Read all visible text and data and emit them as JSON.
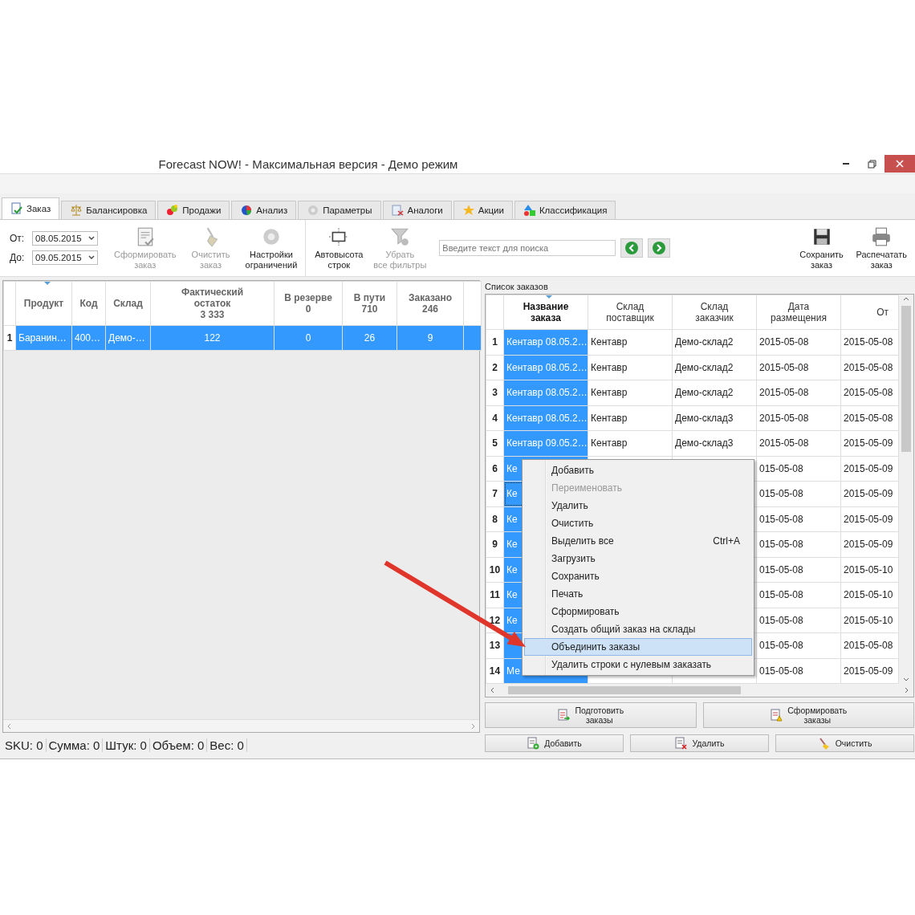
{
  "window": {
    "title": "Forecast NOW! - Максимальная версия - Демо режим"
  },
  "tabs": [
    {
      "label": "Заказ",
      "selected": true
    },
    {
      "label": "Балансировка",
      "selected": false
    },
    {
      "label": "Продажи",
      "selected": false
    },
    {
      "label": "Анализ",
      "selected": false
    },
    {
      "label": "Параметры",
      "selected": false
    },
    {
      "label": "Аналоги",
      "selected": false
    },
    {
      "label": "Акции",
      "selected": false
    },
    {
      "label": "Классификация",
      "selected": false
    }
  ],
  "toolbar": {
    "date_from": {
      "label": "От:",
      "value": "08.05.2015"
    },
    "date_to": {
      "label": "До:",
      "value": "09.05.2015"
    },
    "order_buttons": [
      {
        "label": "Сформировать\nзаказ",
        "disabled": true
      },
      {
        "label": "Очистить\nзаказ",
        "disabled": true
      },
      {
        "label": "Настройки\nограничений",
        "disabled": false
      }
    ],
    "view_buttons": [
      {
        "label": "Автовысота\nстрок",
        "disabled": false
      },
      {
        "label": "Убрать\nвсе фильтры",
        "disabled": true
      }
    ],
    "search": {
      "placeholder": "Введите текст для поиска"
    },
    "file_buttons": [
      {
        "label": "Сохранить\nзаказ",
        "disabled": false
      },
      {
        "label": "Распечатать\nзаказ",
        "disabled": false
      }
    ]
  },
  "products": {
    "columns": [
      {
        "label": "Продукт",
        "sorted": true
      },
      {
        "label": "Код",
        "sorted": false
      },
      {
        "label": "Склад",
        "sorted": false
      },
      {
        "label": "Фактический\nостаток",
        "total": "3 333",
        "sorted": false
      },
      {
        "label": "В резерве",
        "total": "0",
        "sorted": false
      },
      {
        "label": "В пути",
        "total": "710",
        "sorted": false
      },
      {
        "label": "Заказано",
        "total": "246",
        "sorted": false
      }
    ],
    "rows": [
      {
        "number": "1",
        "selected": true,
        "cells": [
          "Баранин…",
          "400…",
          "Демо-…",
          "122",
          "0",
          "26",
          "9"
        ]
      }
    ]
  },
  "status_bar": [
    "SKU: 0",
    "Сумма: 0",
    "Штук: 0",
    "Объем: 0",
    "Вес: 0"
  ],
  "orders": {
    "title": "Список заказов",
    "columns": [
      {
        "label": "Название\nзаказа",
        "sorted": true
      },
      {
        "label": "Склад\nпоставщик",
        "sorted": false
      },
      {
        "label": "Склад\nзаказчик",
        "sorted": false
      },
      {
        "label": "Дата\nразмещения",
        "sorted": false
      },
      {
        "label": "От",
        "sorted": false
      }
    ],
    "rows": [
      {
        "number": "1",
        "selected": true,
        "name": "Кентавр 08.05.2…",
        "supplier": "Кентавр",
        "customer": "Демо-склад2",
        "placed": "2015-05-08",
        "from": "2015-05-08"
      },
      {
        "number": "2",
        "selected": true,
        "name": "Кентавр 08.05.2…",
        "supplier": "Кентавр",
        "customer": "Демо-склад2",
        "placed": "2015-05-08",
        "from": "2015-05-08"
      },
      {
        "number": "3",
        "selected": true,
        "name": "Кентавр 08.05.2…",
        "supplier": "Кентавр",
        "customer": "Демо-склад2",
        "placed": "2015-05-08",
        "from": "2015-05-08"
      },
      {
        "number": "4",
        "selected": true,
        "name": "Кентавр 08.05.2…",
        "supplier": "Кентавр",
        "customer": "Демо-склад3",
        "placed": "2015-05-08",
        "from": "2015-05-08"
      },
      {
        "number": "5",
        "selected": true,
        "name": "Кентавр 09.05.2…",
        "supplier": "Кентавр",
        "customer": "Демо-склад3",
        "placed": "2015-05-08",
        "from": "2015-05-09"
      },
      {
        "number": "6",
        "selected": true,
        "name": "Ке",
        "placed": "015-05-08",
        "from": "2015-05-09"
      },
      {
        "number": "7",
        "selected": true,
        "name": "Ке",
        "placed": "015-05-08",
        "from": "2015-05-09"
      },
      {
        "number": "8",
        "selected": true,
        "name": "Ке",
        "placed": "015-05-08",
        "from": "2015-05-09"
      },
      {
        "number": "9",
        "selected": true,
        "name": "Ке",
        "placed": "015-05-08",
        "from": "2015-05-09"
      },
      {
        "number": "10",
        "selected": true,
        "name": "Ке",
        "placed": "015-05-08",
        "from": "2015-05-10"
      },
      {
        "number": "11",
        "selected": true,
        "name": "Ке",
        "placed": "015-05-08",
        "from": "2015-05-10"
      },
      {
        "number": "12",
        "selected": true,
        "name": "Ке",
        "placed": "015-05-08",
        "from": "2015-05-10"
      },
      {
        "number": "13",
        "selected": true,
        "placed": "015-05-08",
        "from": "2015-05-08"
      },
      {
        "number": "14",
        "selected": true,
        "name": "Ме",
        "placed": "015-05-08",
        "from": "2015-05-09"
      }
    ]
  },
  "context_menu": [
    {
      "label": "Добавить",
      "disabled": false,
      "selected": false
    },
    {
      "label": "Переименовать",
      "disabled": true,
      "selected": false
    },
    {
      "label": "Удалить",
      "disabled": false,
      "selected": false
    },
    {
      "label": "Очистить",
      "disabled": false,
      "selected": false
    },
    {
      "label": "Выделить все",
      "shortcut": "Ctrl+A",
      "disabled": false,
      "selected": false
    },
    {
      "label": "Загрузить",
      "disabled": false,
      "selected": false
    },
    {
      "label": "Сохранить",
      "disabled": false,
      "selected": false
    },
    {
      "label": "Печать",
      "disabled": false,
      "selected": false
    },
    {
      "label": "Сформировать",
      "disabled": false,
      "selected": false
    },
    {
      "label": "Создать общий заказ на склады",
      "disabled": false,
      "selected": false
    },
    {
      "label": "Объединить заказы",
      "disabled": false,
      "selected": true
    },
    {
      "label": "Удалить строки с нулевым заказать",
      "disabled": false,
      "selected": false
    }
  ],
  "order_actions": [
    {
      "label": "Подготовить\nзаказы"
    },
    {
      "label": "Сформировать\nзаказы"
    }
  ],
  "row_actions": [
    {
      "label": "Добавить"
    },
    {
      "label": "Удалить"
    },
    {
      "label": "Очистить"
    }
  ]
}
